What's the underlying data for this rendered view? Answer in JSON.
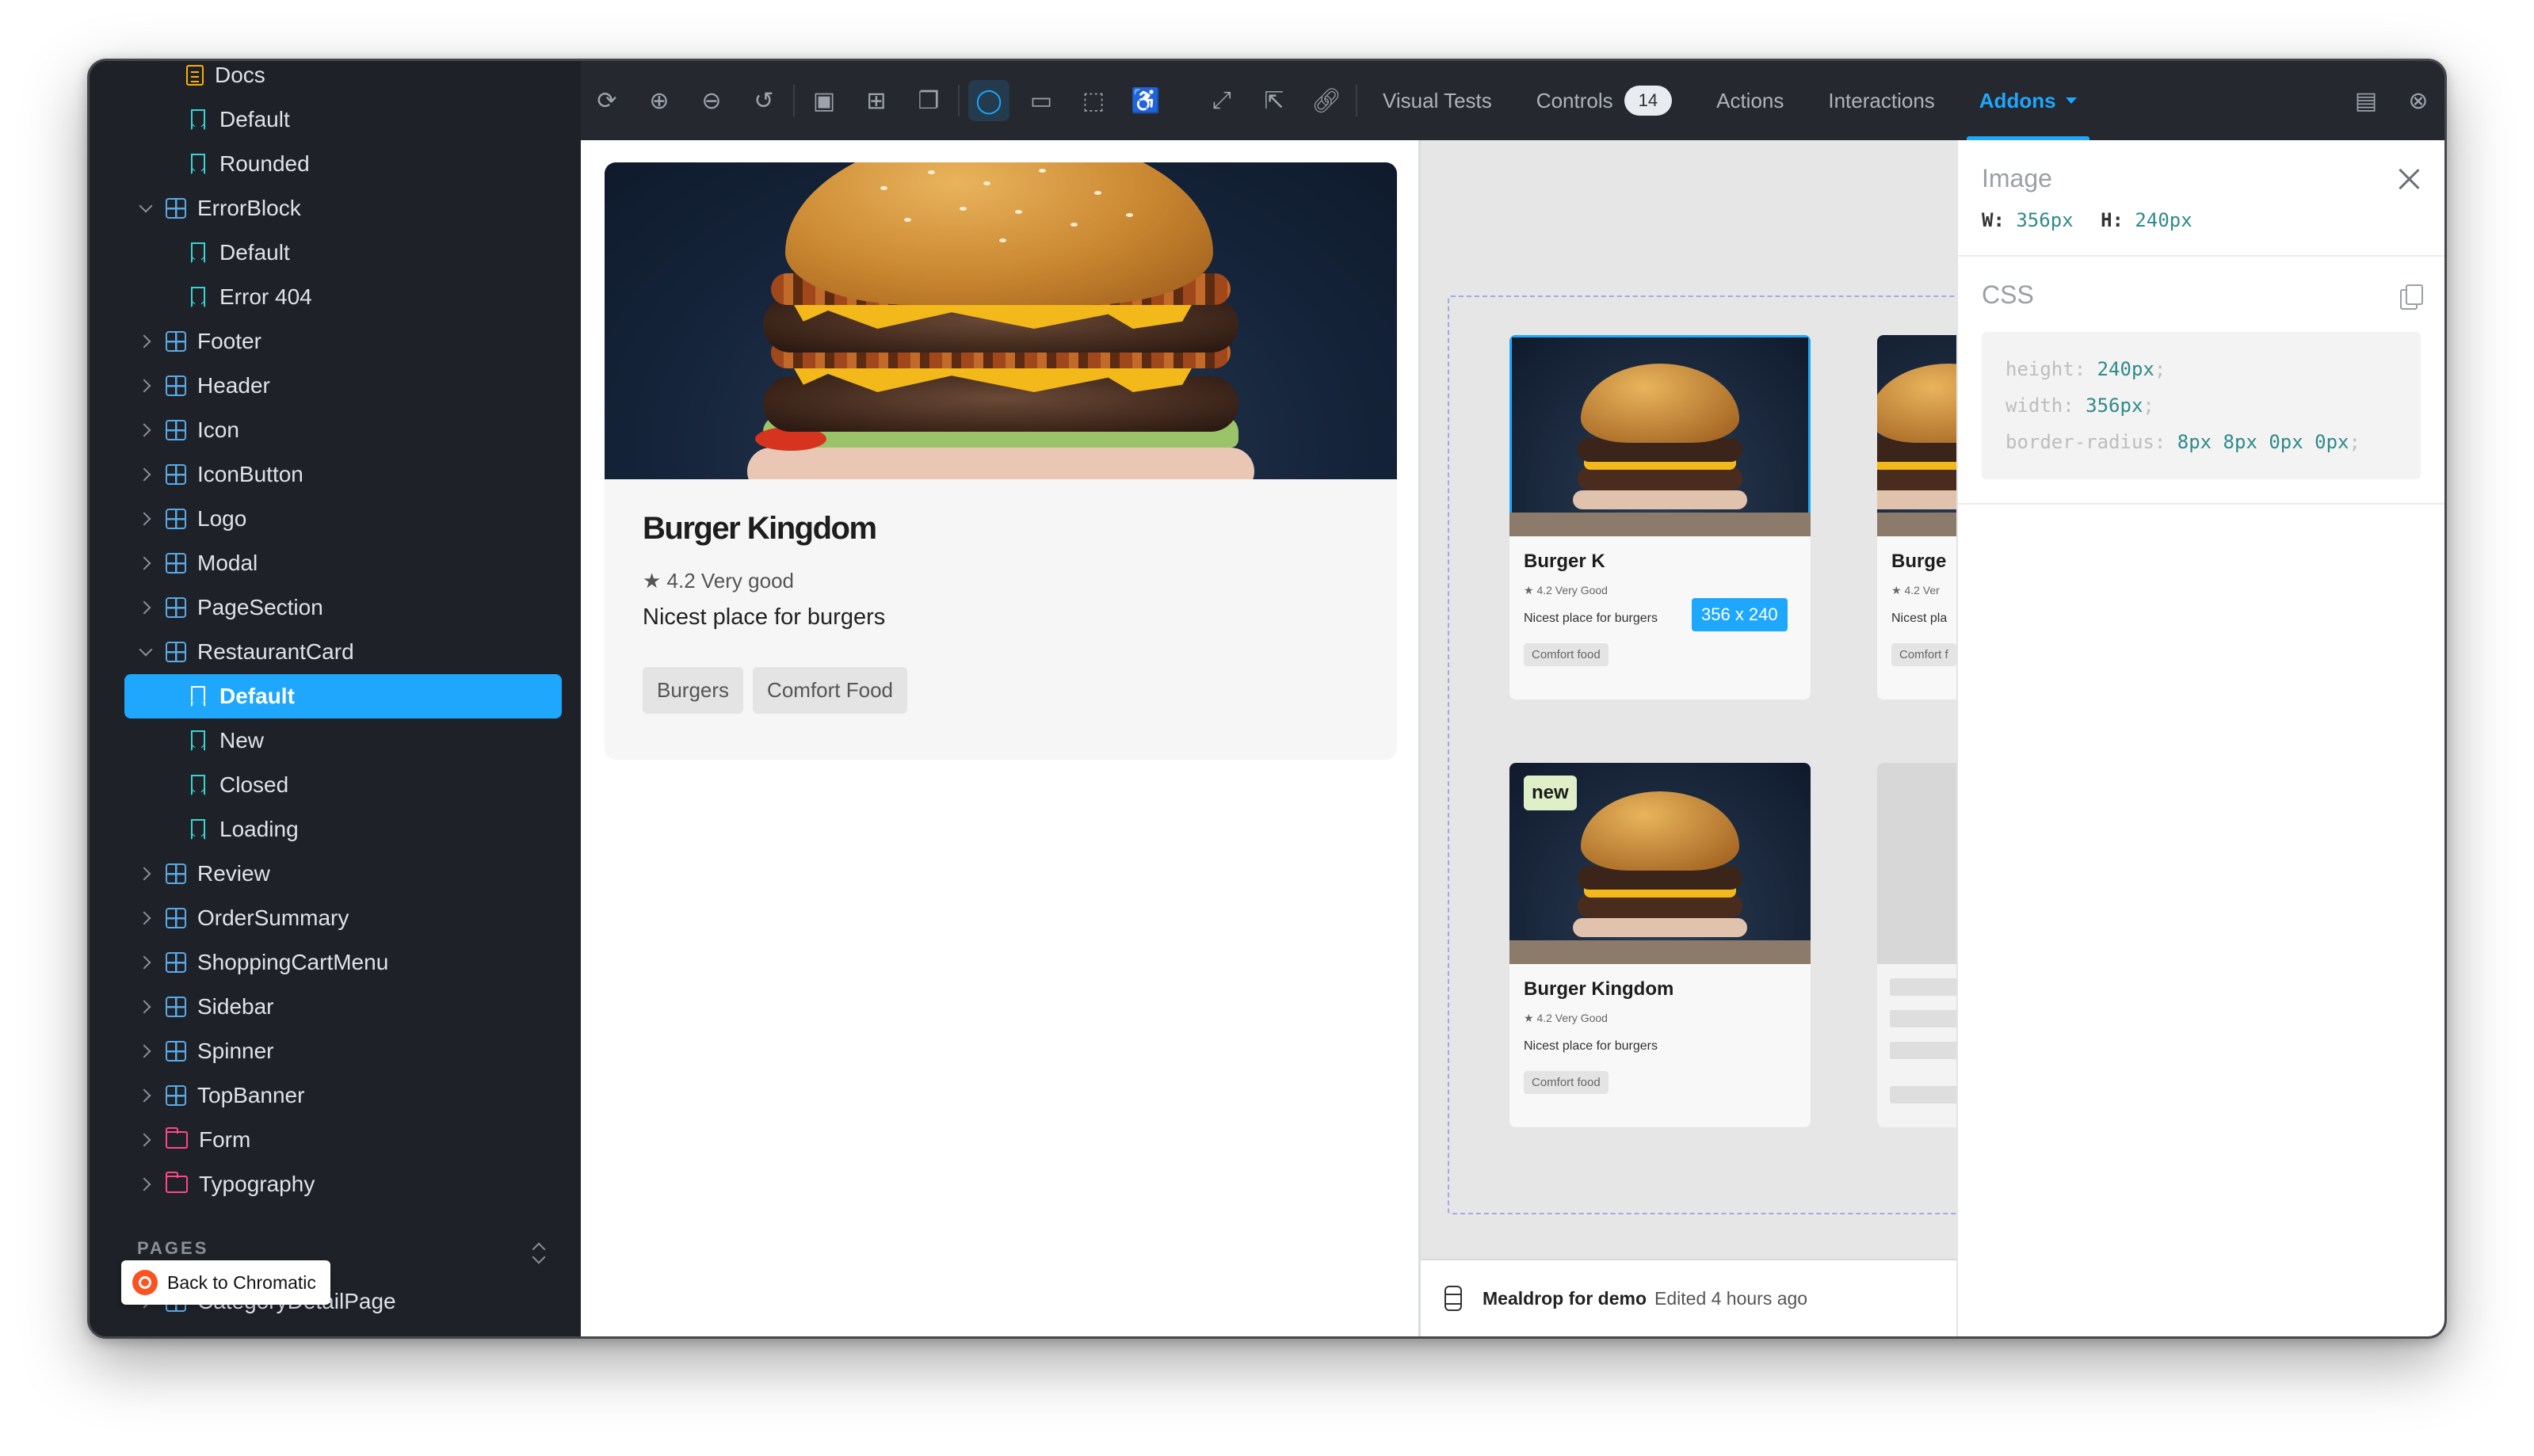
{
  "sidebar": {
    "items": [
      {
        "label": "Docs",
        "kind": "doc",
        "level": 2
      },
      {
        "label": "Default",
        "kind": "story",
        "level": 2
      },
      {
        "label": "Rounded",
        "kind": "story",
        "level": 2
      },
      {
        "label": "ErrorBlock",
        "kind": "component",
        "level": 1,
        "open": true
      },
      {
        "label": "Default",
        "kind": "story",
        "level": 2
      },
      {
        "label": "Error 404",
        "kind": "story",
        "level": 2
      },
      {
        "label": "Footer",
        "kind": "component",
        "level": 1
      },
      {
        "label": "Header",
        "kind": "component",
        "level": 1
      },
      {
        "label": "Icon",
        "kind": "component",
        "level": 1
      },
      {
        "label": "IconButton",
        "kind": "component",
        "level": 1
      },
      {
        "label": "Logo",
        "kind": "component",
        "level": 1
      },
      {
        "label": "Modal",
        "kind": "component",
        "level": 1
      },
      {
        "label": "PageSection",
        "kind": "component",
        "level": 1
      },
      {
        "label": "RestaurantCard",
        "kind": "component",
        "level": 1,
        "open": true
      },
      {
        "label": "Default",
        "kind": "story",
        "level": 2,
        "selected": true
      },
      {
        "label": "New",
        "kind": "story",
        "level": 2
      },
      {
        "label": "Closed",
        "kind": "story",
        "level": 2
      },
      {
        "label": "Loading",
        "kind": "story",
        "level": 2
      },
      {
        "label": "Review",
        "kind": "component",
        "level": 1
      },
      {
        "label": "OrderSummary",
        "kind": "component",
        "level": 1
      },
      {
        "label": "ShoppingCartMenu",
        "kind": "component",
        "level": 1
      },
      {
        "label": "Sidebar",
        "kind": "component",
        "level": 1
      },
      {
        "label": "Spinner",
        "kind": "component",
        "level": 1
      },
      {
        "label": "TopBanner",
        "kind": "component",
        "level": 1
      },
      {
        "label": "Form",
        "kind": "folder",
        "level": 1
      },
      {
        "label": "Typography",
        "kind": "folder",
        "level": 1
      }
    ],
    "pages_header": "PAGES",
    "pages_items": [
      {
        "label": "CategoryDetailPage"
      }
    ],
    "back_button": "Back to Chromatic"
  },
  "toolbar": {
    "icons": [
      "reload-icon",
      "zoom-in-icon",
      "zoom-out-icon",
      "zoom-reset-icon",
      "background-icon",
      "grid-icon",
      "outline-icon",
      "measure-icon",
      "viewport-icon",
      "measure-box-icon",
      "accessibility-icon",
      "fullscreen-icon",
      "open-new-tab-icon",
      "copy-link-icon"
    ],
    "tabs": {
      "visual_tests": "Visual Tests",
      "controls": "Controls",
      "controls_count": "14",
      "actions": "Actions",
      "interactions": "Interactions",
      "addons": "Addons"
    }
  },
  "card": {
    "title": "Burger Kingdom",
    "rating": "★ 4.2 Very good",
    "description": "Nicest place for burgers",
    "chips": [
      "Burgers",
      "Comfort Food"
    ]
  },
  "figma": {
    "cards": [
      {
        "title": "Burger K",
        "rating": "★ 4.2  Very Good",
        "description": "Nicest place for burgers",
        "chip": "Comfort food"
      },
      {
        "title": "Burge",
        "rating": "★ 4.2  Ver",
        "description": "Nicest pla",
        "chip": "Comfort f"
      },
      {
        "title": "Burger Kingdom",
        "rating": "★ 4.2  Very Good",
        "description": "Nicest place for burgers",
        "chip": "Comfort food",
        "badge": "new"
      }
    ],
    "dimension_label": "356 x 240",
    "footer_file": "Mealdrop for demo",
    "footer_edited": "Edited 4 hours ago"
  },
  "panel": {
    "image_title": "Image",
    "w_label": "W:",
    "w_value": "356px",
    "h_label": "H:",
    "h_value": "240px",
    "css_title": "CSS",
    "css": [
      {
        "prop": "height:",
        "value": "240px",
        "end": ";"
      },
      {
        "prop": "width:",
        "value": "356px",
        "end": ";"
      },
      {
        "prop": "border-radius:",
        "value": "8px 8px 0px 0px",
        "end": ";"
      }
    ]
  },
  "colors": {
    "accent": "#1ea7fd",
    "sidebar_bg": "#1e2228",
    "story_icon": "#37d5d3",
    "component_icon": "#5aa9e6",
    "folder_icon": "#ff4785"
  }
}
